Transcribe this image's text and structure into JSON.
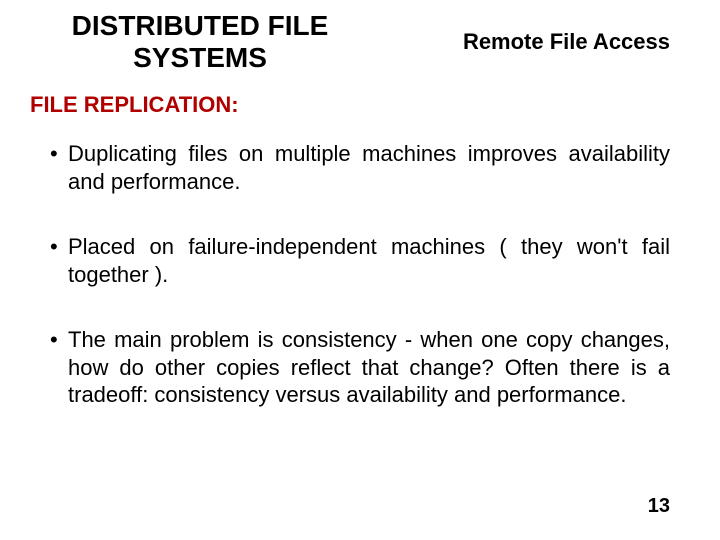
{
  "header": {
    "title_line1": "DISTRIBUTED FILE",
    "title_line2": "SYSTEMS",
    "subtitle": "Remote File Access"
  },
  "section_heading": "FILE REPLICATION:",
  "bullets": [
    "Duplicating files on multiple machines improves availability and performance.",
    "Placed on failure-independent machines ( they won't fail together ).",
    "The main problem is consistency - when one copy changes, how do other copies reflect that change? Often there is a tradeoff: consistency versus availability and performance."
  ],
  "page_number": "13"
}
